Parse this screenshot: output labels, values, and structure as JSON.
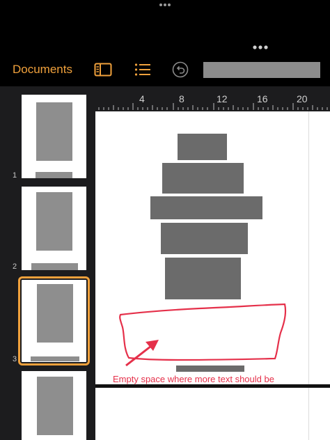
{
  "toolbar": {
    "documents_label": "Documents"
  },
  "sidebar": {
    "pages": [
      {
        "number": "1"
      },
      {
        "number": "2"
      },
      {
        "number": "3",
        "selected": true
      }
    ]
  },
  "ruler": {
    "labels": [
      "4",
      "8",
      "12",
      "16",
      "20"
    ]
  },
  "annotation": {
    "text": "Empty space where more text should be",
    "color": "#e5304a"
  },
  "colors": {
    "accent": "#f0a13c",
    "placeholder": "#8e8e8e"
  },
  "icons": [
    "more-icon",
    "sidebar-icon",
    "list-icon",
    "undo-icon",
    "arrow-icon"
  ]
}
